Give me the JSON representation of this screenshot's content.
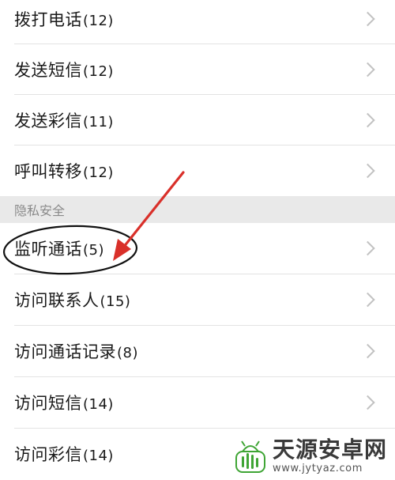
{
  "rows_top": [
    {
      "label": "拨打电话",
      "count": "(12)"
    },
    {
      "label": "发送短信",
      "count": "(12)"
    },
    {
      "label": "发送彩信",
      "count": "(11)"
    },
    {
      "label": "呼叫转移",
      "count": "(12)"
    }
  ],
  "section": {
    "title": "隐私安全"
  },
  "rows_privacy": [
    {
      "label": "监听通话",
      "count": "(5)"
    },
    {
      "label": "访问联系人",
      "count": "(15)"
    },
    {
      "label": "访问通话记录",
      "count": "(8)"
    },
    {
      "label": "访问短信",
      "count": "(14)"
    },
    {
      "label": "访问彩信",
      "count": "(14)"
    }
  ],
  "watermark": {
    "title": "天源安卓网",
    "url": "www.jytyaz.com"
  },
  "colors": {
    "annotation_arrow": "#d9302a",
    "annotation_circle": "#111111",
    "watermark_green": "#3fa535"
  }
}
